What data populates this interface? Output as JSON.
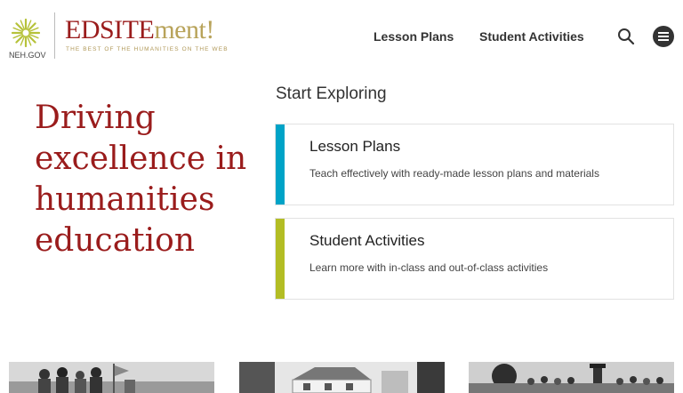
{
  "header": {
    "neh_label": "NEH.GOV",
    "brand_main": "EDSITE",
    "brand_accent": "ment!",
    "tagline": "THE BEST OF THE HUMANITIES ON THE WEB",
    "nav": [
      {
        "label": "Lesson Plans"
      },
      {
        "label": "Student Activities"
      }
    ],
    "search_icon": "search-icon",
    "menu_icon": "hamburger-menu-icon"
  },
  "hero": {
    "title": "Driving excellence in humanities education"
  },
  "explore": {
    "title": "Start Exploring",
    "cards": [
      {
        "title": "Lesson Plans",
        "description": "Teach effectively with ready-made lesson plans and materials",
        "accent": "#00a3c7"
      },
      {
        "title": "Student Activities",
        "description": "Learn more with in-class and out-of-class activities",
        "accent": "#b3bd24"
      }
    ]
  },
  "colors": {
    "brand_red": "#9a1c1c",
    "brand_gold": "#b8a35a",
    "logo_green": "#b6c23a"
  }
}
